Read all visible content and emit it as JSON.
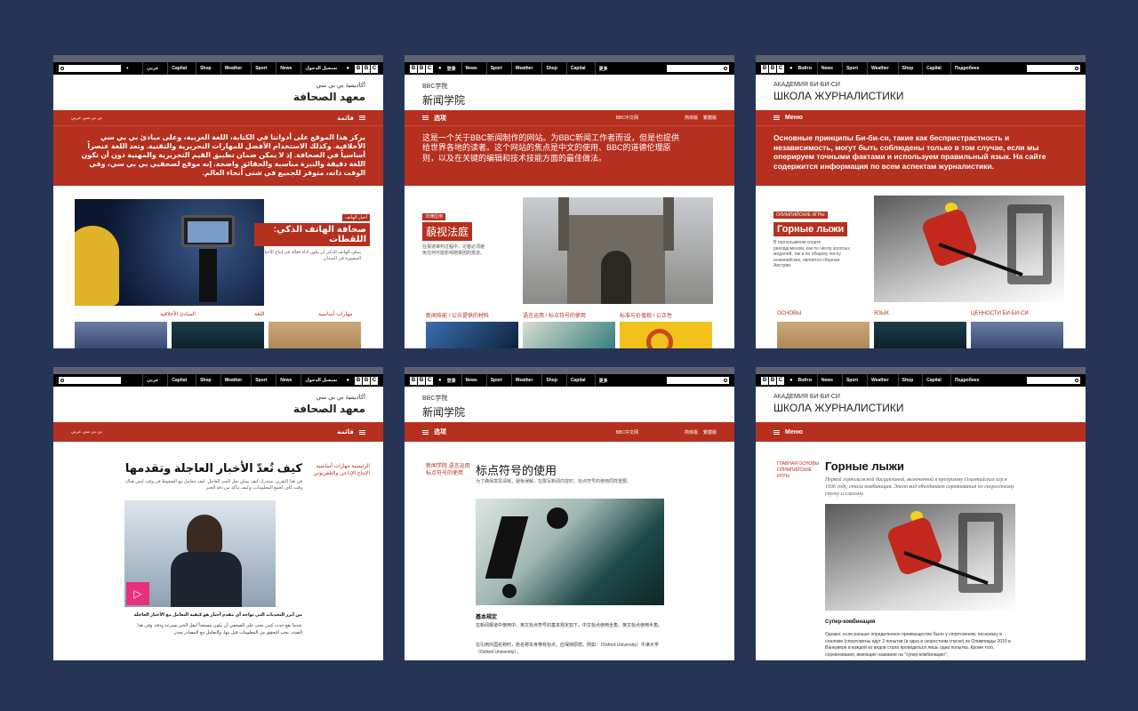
{
  "panels": {
    "arabic_home": {
      "nav": [
        "عربي",
        "Capital",
        "Shop",
        "Weather",
        "Sport",
        "News"
      ],
      "signin": "تسجيل الدخول",
      "brand_sub": "أكاديمية بي بي سي",
      "brand_main": "معهد الصحافة",
      "menu": "قائمة",
      "lang_link": "بي بي سي عربي",
      "intro": "يركز هذا الموقع على أدواتنا في الكتابة، اللغة العربية، وعلى مبادئ بي بي سي الأخلاقية. وكذلك الاستخدام الأفضل للمهارات التحريرية والتقنية. وتعد اللغة عنصراً أساسياً في الصحافة. إذ لا يمكن ضمان تطبيق القيم التحريرية والمهنية دون أن تكون اللغة دقيقة والنبرة مناسبة والحقائق واضحة. إنه موقع لصحفيي بي بي سي، وفي الوقت ذاته، متوفر للجميع في شتى أنحاء العالم.",
      "feature_kicker": "أخبار الهاتف",
      "feature_title": "صحافة الهاتف الذكي: اللقطات",
      "feature_desc": "يمكن للهاتف الذكي أن يكون أداة فعالة في إنتاج الأخبار المصورة في الميدان",
      "cats": [
        "المبادئ الأخلاقية",
        "اللغة",
        "مهارات أساسية"
      ]
    },
    "chinese_home": {
      "nav": [
        "News",
        "Sport",
        "Weather",
        "Shop",
        "Capital",
        "更多"
      ],
      "signin": "登录",
      "brand_sub": "BBC学院",
      "brand_main": "新闻学院",
      "menu": "选项",
      "lang_link": "BBC中文网",
      "script_toggle": [
        "简体版",
        "繁體版"
      ],
      "intro": "这是一个关于BBC新闻制作的网站。为BBC新闻工作者而设，但是也提供给世界各地的读者。这个网站的焦点是中文的使用、BBC的道德伦理原则，以及在关键的编辑和技术技能方面的最佳做法。",
      "feature_kicker": "法律应用",
      "feature_title": "藐视法庭",
      "feature_desc": "在报道审判过程中，记者必须避免任何可能影响陪审团的报道。",
      "cats": [
        "新闻技能 / 公众提供的材料",
        "语言运用 / 标点符号的使用",
        "标准与价值观 / 公正性"
      ]
    },
    "russian_home": {
      "nav": [
        "News",
        "Sport",
        "Weather",
        "Shop",
        "Capital",
        "Подробнее"
      ],
      "signin": "Войти",
      "brand_sub": "АКАДЕМИЯ БИ-БИ-СИ",
      "brand_main": "ШКОЛА ЖУРНАЛИСТИКИ",
      "menu": "Меню",
      "intro": "Основные принципы Би-би-си, такие как беспристрастность и независимость, могут быть соблюдены только в том случае, если мы оперируем точными фактами и используем правильный язык. На сайте содержится информация по всем аспектам журналистики.",
      "feature_kicker": "ОЛИМПИЙСКИЕ ИГРЫ",
      "feature_title": "Горные лыжи",
      "feature_desc": "В горнолыжном спорте рекордсменом, как по числу золотых медалей, так и по общему числу олимпийских, является сборная Австрии.",
      "cats": [
        "ОСНОВЫ",
        "ЯЗЫК",
        "ЦЕННОСТИ БИ-БИ-СИ"
      ]
    },
    "arabic_article": {
      "nav": [
        "عربي",
        "Capital",
        "Shop",
        "Weather",
        "Sport",
        "News"
      ],
      "signin": "تسجيل الدخول",
      "brand_sub": "أكاديمية بي بي سي",
      "brand_main": "معهد الصحافة",
      "menu": "قائمة",
      "lang_link": "بي بي سي عربي",
      "side_links": "الرئيسية مهارات أساسية الإنتاج الإذاعي والتلفزيوني",
      "title": "كيف تُعدّ الأخبار العاجلة وتقدمها",
      "lead": "في هذا التقرير، ستدرك كيف يمكن نقل الخبر العاجل. كيف تتعامل مع الضغوط في وقت ليس هناك وقت كاف لجمع المعلومات، وكيف تتأكد من دقة الخبر",
      "caption": "من أبرز التحديات التي تواجه أي مقدم أخبار هو كيفية التعامل مع الأخبار العاجلة",
      "body": "عندما يقع حدث كبير، يجب على الصحفي أن يكون مستعداً لنقل الخبر بسرعة ودقة. وفي هذا الصدد، يجب التحقق من المعلومات قبل بثها، والتعامل مع المصادر بحذر."
    },
    "chinese_article": {
      "nav": [
        "News",
        "Sport",
        "Weather",
        "Shop",
        "Capital",
        "更多"
      ],
      "signin": "登录",
      "brand_sub": "BBC学院",
      "brand_main": "新闻学院",
      "menu": "选项",
      "lang_link": "BBC中文网",
      "script_toggle": [
        "简体版",
        "繁體版"
      ],
      "side_links": "新闻学院 语言运用 标点符号的使用",
      "title": "标点符号的使用",
      "lead": "为了确保意思清晰，避免误解，在撰写新闻内容时，标点符号的使用同样重要。",
      "section": "基本规定",
      "body1": "在新闻报道中使用中、英文标点符号的基本规定如下。中文标点使用全角，英文标点使用半角。",
      "body2": "在引用外国名称时，若名称本身带有标点，应保持原样。例如：（Oxford University）牛津大学（Oxford University）。"
    },
    "russian_article": {
      "nav": [
        "News",
        "Sport",
        "Weather",
        "Shop",
        "Capital",
        "Подробнее"
      ],
      "signin": "Войти",
      "brand_sub": "АКАДЕМИЯ БИ-БИ-СИ",
      "brand_main": "ШКОЛА ЖУРНАЛИСТИКИ",
      "menu": "Меню",
      "side_links": "ГЛАВНАЯ ОСНОВЫ ОЛИМПИЙСКИЕ ИГРЫ",
      "title": "Горные лыжи",
      "lead": "Первой горнолыжной дисциплиной, включенной в программу Олимпийских игр в 1936 году, стала комбинация. Этот вид объединяет соревнования по скоростному спуску и слалому.",
      "section": "Супер-комбинация",
      "body": "Однако, если раньше определенное преимущество было у спортсменов, поскольку в слаломе (спортсмены едут 2 попытки (и одна в скоростном спуске) из Олимпиады 2010 в Ванкувере в каждой из видов стала проводиться лишь одна попытка. Кроме того, соревнования, имеющие название на \"супер-комбинацию\","
    }
  },
  "bbc_letters": [
    "B",
    "B",
    "C"
  ],
  "colors": {
    "bg": "#263555",
    "red": "#b5301f",
    "bar": "#000000"
  }
}
